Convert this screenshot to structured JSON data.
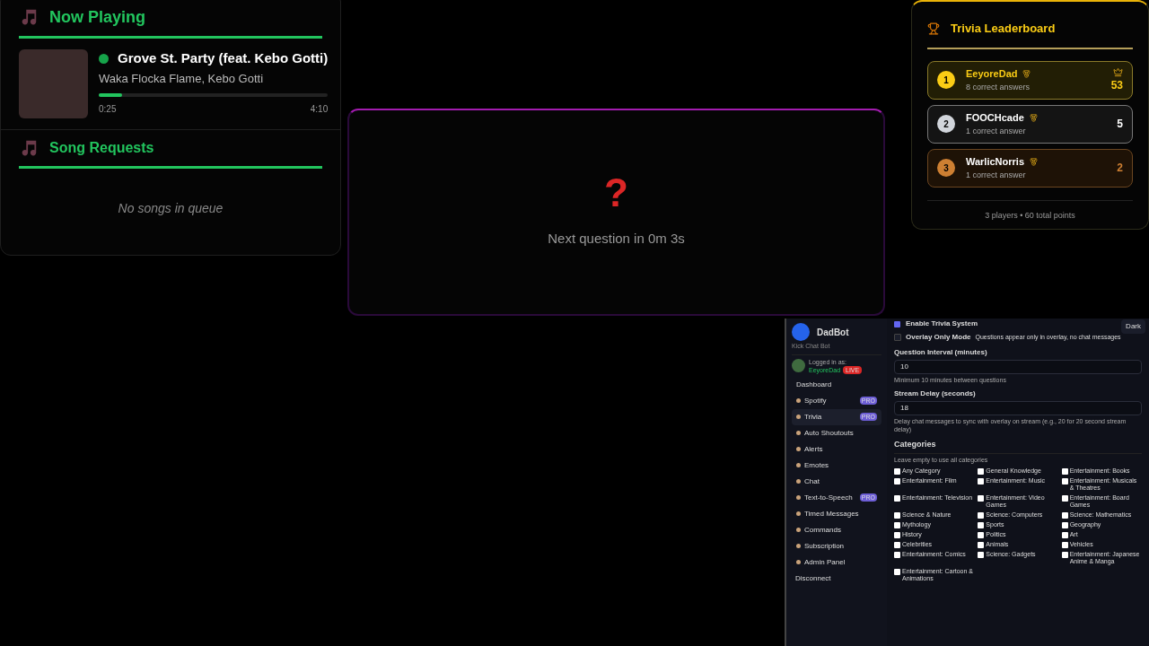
{
  "now_playing": {
    "title": "Now Playing",
    "track": "Grove St. Party (feat. Kebo Gotti)",
    "artist": "Waka Flocka Flame, Kebo Gotti",
    "playing": true,
    "level": 0.1,
    "elapsed": "0:25",
    "duration": "4:10"
  },
  "song_requests": {
    "title": "Song Requests",
    "empty": "No songs in queue"
  },
  "trivia": {
    "icon": "?",
    "countdown": "Next question in 0m 3s"
  },
  "leaderboard": {
    "title": "Trivia Leaderboard",
    "players": [
      {
        "rank": "1",
        "name": "EeyoreDad",
        "answers": "8 correct answers",
        "points": "53",
        "color": "#facc15",
        "leader": true
      },
      {
        "rank": "2",
        "name": "FOOCHcade",
        "answers": "1 correct answer",
        "points": "5",
        "color": "#d1d5db",
        "leader": false
      },
      {
        "rank": "3",
        "name": "WarlicNorris",
        "answers": "1 correct answer",
        "points": "2",
        "color": "#cd7f32",
        "leader": false
      }
    ],
    "footer": "3 players • 60 total points"
  },
  "dashboard": {
    "brand": "DadBot",
    "subtitle": "Kick Chat Bot",
    "logged_in_label": "Logged in as:",
    "user": "EeyoreDad",
    "live": "LIVE",
    "nav": [
      {
        "label": "Dashboard",
        "selected": false
      },
      {
        "label": "Spotify",
        "selected": false,
        "pro": "PRO"
      },
      {
        "label": "Trivia",
        "selected": true,
        "pro": "PRO"
      },
      {
        "label": "Auto Shoutouts",
        "selected": false
      },
      {
        "label": "Alerts",
        "selected": false
      },
      {
        "label": "Emotes",
        "selected": false
      },
      {
        "label": "Chat",
        "selected": false
      },
      {
        "label": "Text-to-Speech",
        "selected": false,
        "pro": "PRO"
      },
      {
        "label": "Timed Messages",
        "selected": false
      },
      {
        "label": "Commands",
        "selected": false
      },
      {
        "label": "Subscription",
        "selected": false
      },
      {
        "label": "Admin Panel",
        "selected": false
      }
    ],
    "disconnect": "Disconnect",
    "theme_button": "Dark",
    "enable": {
      "label": "Enable Trivia System",
      "checked": true
    },
    "overlay_only": {
      "label": "Overlay Only Mode",
      "hint": "Questions appear only in overlay, no chat messages",
      "checked": false
    },
    "interval": {
      "label": "Question Interval (minutes)",
      "value": "10",
      "help": "Minimum 10 minutes between questions"
    },
    "delay": {
      "label": "Stream Delay (seconds)",
      "value": "18",
      "help": "Delay chat messages to sync with overlay on stream (e.g., 20 for 20 second stream delay)"
    },
    "categories_title": "Categories",
    "categories_help": "Leave empty to use all categories",
    "categories": [
      {
        "label": "Any Category",
        "checked": false
      },
      {
        "label": "General Knowledge",
        "checked": false
      },
      {
        "label": "Entertainment: Books",
        "checked": false
      },
      {
        "label": "Entertainment: Film",
        "checked": false
      },
      {
        "label": "Entertainment: Music",
        "checked": false
      },
      {
        "label": "Entertainment: Musicals & Theatres",
        "checked": false
      },
      {
        "label": "Entertainment: Television",
        "checked": false
      },
      {
        "label": "Entertainment: Video Games",
        "checked": false
      },
      {
        "label": "Entertainment: Board Games",
        "checked": false
      },
      {
        "label": "Science & Nature",
        "checked": false
      },
      {
        "label": "Science: Computers",
        "checked": false
      },
      {
        "label": "Science: Mathematics",
        "checked": false
      },
      {
        "label": "Mythology",
        "checked": false
      },
      {
        "label": "Sports",
        "checked": false
      },
      {
        "label": "Geography",
        "checked": false
      },
      {
        "label": "History",
        "checked": false
      },
      {
        "label": "Politics",
        "checked": false
      },
      {
        "label": "Art",
        "checked": false
      },
      {
        "label": "Celebrities",
        "checked": false
      },
      {
        "label": "Animals",
        "checked": false
      },
      {
        "label": "Vehicles",
        "checked": false
      },
      {
        "label": "Entertainment: Comics",
        "checked": false
      },
      {
        "label": "Science: Gadgets",
        "checked": false
      },
      {
        "label": "Entertainment: Japanese Anime & Manga",
        "checked": false
      },
      {
        "label": "Entertainment: Cartoon & Animations",
        "checked": false
      }
    ]
  }
}
